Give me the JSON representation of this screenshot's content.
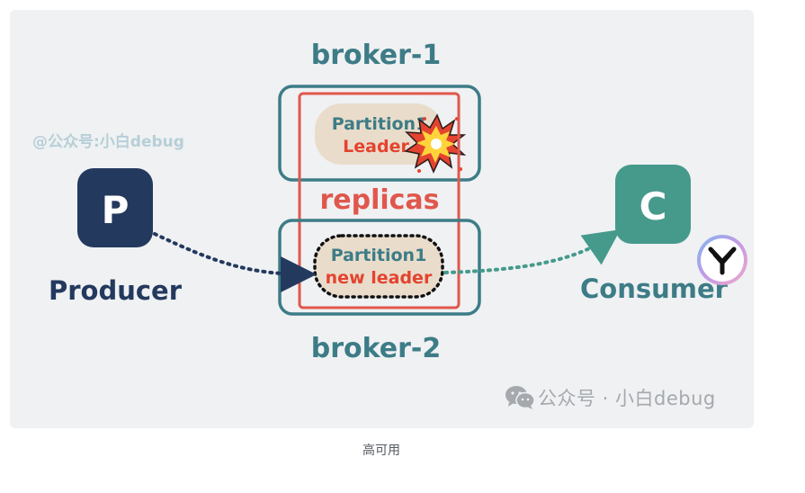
{
  "diagram": {
    "broker_top_label": "broker-1",
    "broker_bottom_label": "broker-2",
    "replicas_label": "replicas",
    "partition_top_line1": "Partition1",
    "partition_top_line2": "Leader",
    "partition_bottom_line1": "Partition1",
    "partition_bottom_line2": "new leader",
    "producer_letter": "P",
    "producer_label": "Producer",
    "consumer_letter": "C",
    "consumer_label": "Consumer"
  },
  "watermarks": {
    "top": "@公众号:小白debug",
    "bottom": "公众号 · 小白debug"
  },
  "caption": "高可用",
  "colors": {
    "panel_bg": "#eff1f3",
    "teal": "#3d7c86",
    "producer_navy": "#24395e",
    "consumer_teal": "#469a8b",
    "replica_red": "#e0574c",
    "partition_fill": "#e9dccb",
    "leader_red": "#e4432f"
  },
  "icons": [
    "explosion-icon",
    "wechat-icon",
    "badge-icon"
  ]
}
